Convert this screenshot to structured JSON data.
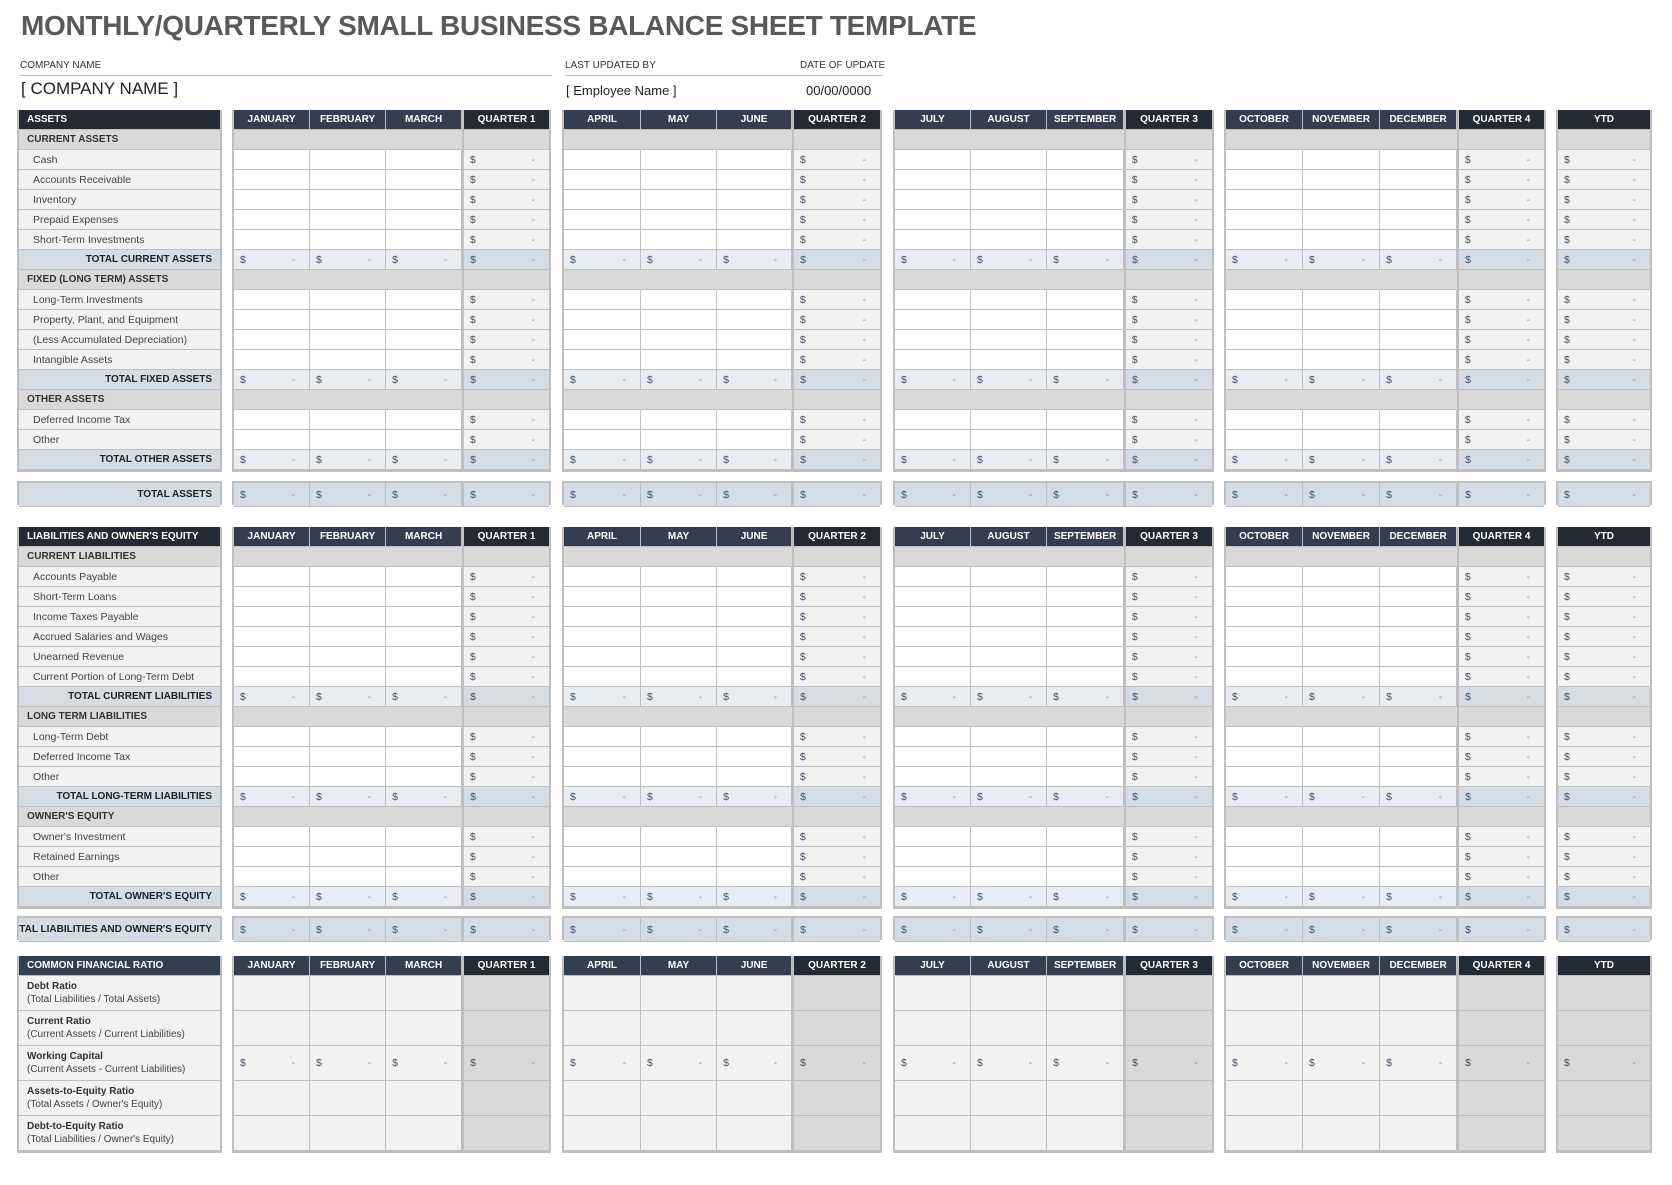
{
  "title": "MONTHLY/QUARTERLY SMALL BUSINESS BALANCE SHEET TEMPLATE",
  "info": {
    "company_label": "COMPANY NAME",
    "company_value": "[ COMPANY NAME ]",
    "updated_by_label": "LAST UPDATED BY",
    "updated_by_value": "[ Employee Name ]",
    "date_label": "DATE OF UPDATE",
    "date_value": "00/00/0000"
  },
  "quarters": [
    {
      "months": [
        "JANUARY",
        "FEBRUARY",
        "MARCH"
      ],
      "total": "QUARTER 1"
    },
    {
      "months": [
        "APRIL",
        "MAY",
        "JUNE"
      ],
      "total": "QUARTER 2"
    },
    {
      "months": [
        "JULY",
        "AUGUST",
        "SEPTEMBER"
      ],
      "total": "QUARTER 3"
    },
    {
      "months": [
        "OCTOBER",
        "NOVEMBER",
        "DECEMBER"
      ],
      "total": "QUARTER 4"
    }
  ],
  "ytd_label": "YTD",
  "money": {
    "symbol": "$",
    "empty": "-"
  },
  "assets": {
    "header": "ASSETS",
    "rows": [
      {
        "type": "section",
        "label": "CURRENT ASSETS"
      },
      {
        "type": "item",
        "label": "Cash"
      },
      {
        "type": "item",
        "label": "Accounts Receivable"
      },
      {
        "type": "item",
        "label": "Inventory"
      },
      {
        "type": "item",
        "label": "Prepaid Expenses"
      },
      {
        "type": "item",
        "label": "Short-Term Investments"
      },
      {
        "type": "total",
        "label": "TOTAL CURRENT ASSETS"
      },
      {
        "type": "section",
        "label": "FIXED (LONG TERM) ASSETS"
      },
      {
        "type": "item",
        "label": "Long-Term Investments"
      },
      {
        "type": "item",
        "label": "Property, Plant, and Equipment"
      },
      {
        "type": "item",
        "label": "(Less Accumulated Depreciation)"
      },
      {
        "type": "item",
        "label": "Intangible Assets"
      },
      {
        "type": "total",
        "label": "TOTAL FIXED ASSETS"
      },
      {
        "type": "section",
        "label": "OTHER ASSETS"
      },
      {
        "type": "item",
        "label": "Deferred Income Tax"
      },
      {
        "type": "item",
        "label": "Other"
      },
      {
        "type": "total",
        "label": "TOTAL OTHER ASSETS"
      }
    ],
    "grand_total": "TOTAL ASSETS"
  },
  "liabilities": {
    "header": "LIABILITIES AND OWNER'S EQUITY",
    "rows": [
      {
        "type": "section",
        "label": "CURRENT LIABILITIES"
      },
      {
        "type": "item",
        "label": "Accounts Payable"
      },
      {
        "type": "item",
        "label": "Short-Term Loans"
      },
      {
        "type": "item",
        "label": "Income Taxes Payable"
      },
      {
        "type": "item",
        "label": "Accrued Salaries and Wages"
      },
      {
        "type": "item",
        "label": "Unearned Revenue"
      },
      {
        "type": "item",
        "label": "Current Portion of Long-Term Debt"
      },
      {
        "type": "total",
        "label": "TOTAL CURRENT LIABILITIES"
      },
      {
        "type": "section",
        "label": "LONG TERM LIABILITIES"
      },
      {
        "type": "item",
        "label": "Long-Term Debt"
      },
      {
        "type": "item",
        "label": "Deferred Income Tax"
      },
      {
        "type": "item",
        "label": "Other"
      },
      {
        "type": "total",
        "label": "TOTAL LONG-TERM LIABILITIES"
      },
      {
        "type": "section",
        "label": "OWNER'S EQUITY"
      },
      {
        "type": "item",
        "label": "Owner's Investment"
      },
      {
        "type": "item",
        "label": "Retained Earnings"
      },
      {
        "type": "item",
        "label": "Other"
      },
      {
        "type": "total",
        "label": "TOTAL OWNER'S EQUITY"
      }
    ],
    "grand_total": "TOTAL LIABILITIES AND OWNER'S EQUITY"
  },
  "ratios": {
    "header": "COMMON FINANCIAL RATIO",
    "rows": [
      {
        "name": "Debt Ratio",
        "formula": "(Total Liabilities / Total Assets)",
        "money": false
      },
      {
        "name": "Current Ratio",
        "formula": "(Current Assets / Current Liabilities)",
        "money": false
      },
      {
        "name": "Working Capital",
        "formula": "(Current Assets - Current Liabilities)",
        "money": true
      },
      {
        "name": "Assets-to-Equity Ratio",
        "formula": "(Total Assets / Owner's Equity)",
        "money": false
      },
      {
        "name": "Debt-to-Equity Ratio",
        "formula": "(Total Liabilities / Owner's Equity)",
        "money": false
      }
    ]
  }
}
